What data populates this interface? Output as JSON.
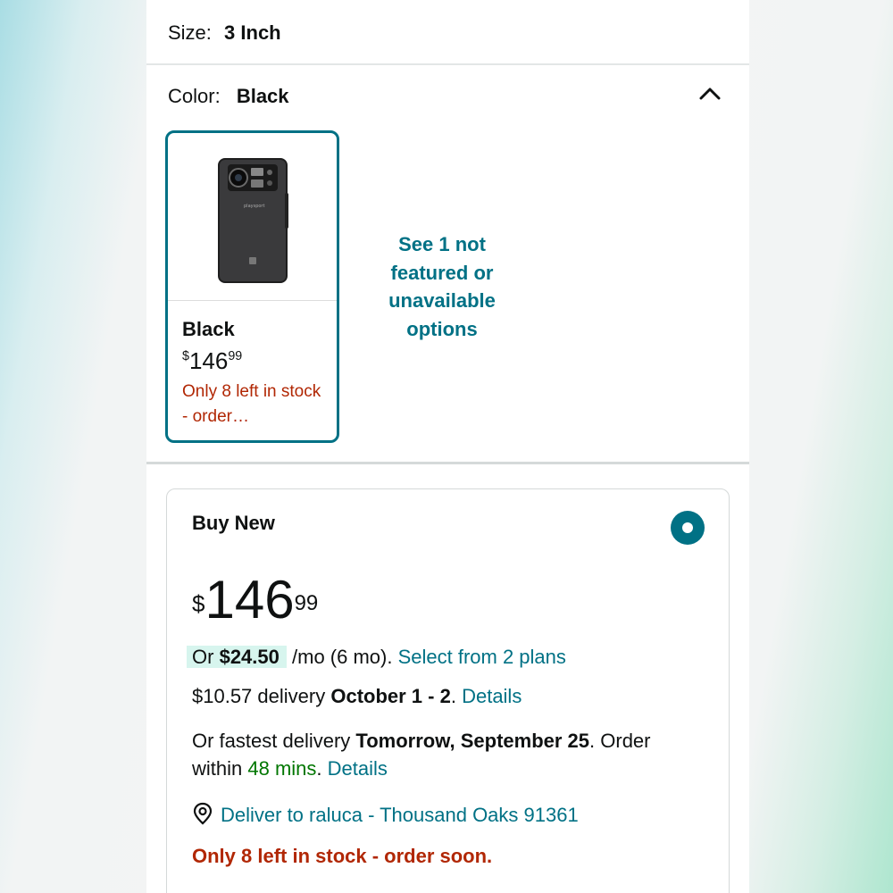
{
  "size": {
    "label": "Size:",
    "value": "3 Inch"
  },
  "color": {
    "label": "Color:",
    "value": "Black",
    "collapse_icon": "chevron-up-icon"
  },
  "swatch": {
    "name": "Black",
    "price_currency": "$",
    "price_whole": "146",
    "price_fraction": "99",
    "stock_text": "Only 8 left in stock - order…"
  },
  "see_more_link": "See 1 not featured or unavailable options",
  "buy_box": {
    "title": "Buy New",
    "price_currency": "$",
    "price_whole": "146",
    "price_fraction": "99",
    "monthly": {
      "prefix": "Or",
      "amount": "$24.50",
      "terms": "/mo (6 mo).",
      "plans_link": "Select from 2 plans"
    },
    "delivery": {
      "cost": "$10.57 delivery",
      "dates": "October 1 - 2",
      "period": ".",
      "details_link": "Details"
    },
    "fastest": {
      "prefix": "Or fastest delivery",
      "date": "Tomorrow, September 25",
      "order_within": ". Order within",
      "time_left": "48 mins",
      "period": ".",
      "details_link": "Details"
    },
    "deliver_to": {
      "icon": "location-pin-icon",
      "text": "Deliver to raluca - Thousand Oaks 91361"
    },
    "stock_notice": "Only 8 left in stock - order soon."
  },
  "colors": {
    "accent": "#007185",
    "warning": "#b12704",
    "success": "#007600",
    "highlight": "#d7f5ee"
  }
}
